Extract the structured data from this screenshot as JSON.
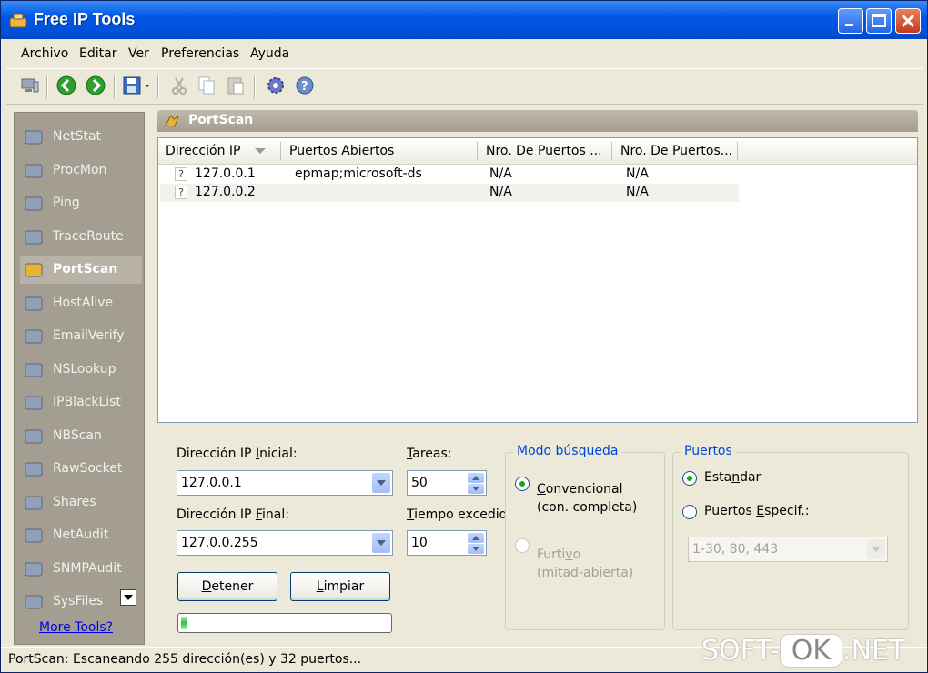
{
  "window": {
    "title": "Free IP Tools"
  },
  "menu": [
    "Archivo",
    "Editar",
    "Ver",
    "Preferencias",
    "Ayuda"
  ],
  "sidebar": {
    "items": [
      {
        "label": "NetStat",
        "icon": "netstat-icon"
      },
      {
        "label": "ProcMon",
        "icon": "procmon-icon"
      },
      {
        "label": "Ping",
        "icon": "ping-icon"
      },
      {
        "label": "TraceRoute",
        "icon": "traceroute-icon"
      },
      {
        "label": "PortScan",
        "icon": "portscan-icon",
        "active": true
      },
      {
        "label": "HostAlive",
        "icon": "hostalive-icon"
      },
      {
        "label": "EmailVerify",
        "icon": "emailverify-icon"
      },
      {
        "label": "NSLookup",
        "icon": "nslookup-icon"
      },
      {
        "label": "IPBlackList",
        "icon": "ipblacklist-icon"
      },
      {
        "label": "NBScan",
        "icon": "nbscan-icon"
      },
      {
        "label": "RawSocket",
        "icon": "rawsocket-icon"
      },
      {
        "label": "Shares",
        "icon": "shares-icon"
      },
      {
        "label": "NetAudit",
        "icon": "netaudit-icon"
      },
      {
        "label": "SNMPAudit",
        "icon": "snmpaudit-icon"
      },
      {
        "label": "SysFiles",
        "icon": "sysfiles-icon"
      }
    ],
    "more_tools": "More Tools?"
  },
  "panel": {
    "title": "PortScan"
  },
  "table": {
    "columns": [
      "Dirección IP",
      "Puertos Abiertos",
      "Nro. De Puertos ...",
      "Nro. De Puertos..."
    ],
    "rows": [
      {
        "status": "?",
        "ip": "127.0.0.1",
        "ports": "epmap;microsoft-ds",
        "n1": "N/A",
        "n2": "N/A"
      },
      {
        "status": "?",
        "ip": "127.0.0.2",
        "ports": "",
        "n1": "N/A",
        "n2": "N/A"
      }
    ]
  },
  "form": {
    "ip_start_label_pre": "Dirección IP ",
    "ip_start_label_key": "I",
    "ip_start_label_post": "nicial:",
    "ip_start_value": "127.0.0.1",
    "ip_end_label_pre": "Dirección IP ",
    "ip_end_label_key": "F",
    "ip_end_label_post": "inal:",
    "ip_end_value": "127.0.0.255",
    "tasks_label_key": "T",
    "tasks_label_post": "areas:",
    "tasks_value": "50",
    "timeout_label_key": "T",
    "timeout_label_post": "iempo excedido",
    "timeout_value": "10",
    "stop_key": "D",
    "stop_post": "etener",
    "clear_key": "L",
    "clear_post": "impiar",
    "progress": 0.02
  },
  "search_mode": {
    "title": "Modo búsqueda",
    "conventional_key": "C",
    "conventional_post": "onvencional",
    "conventional_sub": "(con. completa)",
    "stealth_pre": "Furti",
    "stealth_key": "v",
    "stealth_post": "o",
    "stealth_sub": "(mitad-abierta)"
  },
  "ports": {
    "title": "Puertos",
    "standard_pre": "Esta",
    "standard_key": "n",
    "standard_post": "dar",
    "specific_pre": "Puertos ",
    "specific_key": "E",
    "specific_post": "specif.:",
    "specific_value": "1-30, 80, 443"
  },
  "status": {
    "text": "PortScan: Escaneando 255 dirección(es) y 32 puertos..."
  },
  "watermark": {
    "pre": "SOFT-",
    "ok": "OK",
    "post": ".NET"
  }
}
